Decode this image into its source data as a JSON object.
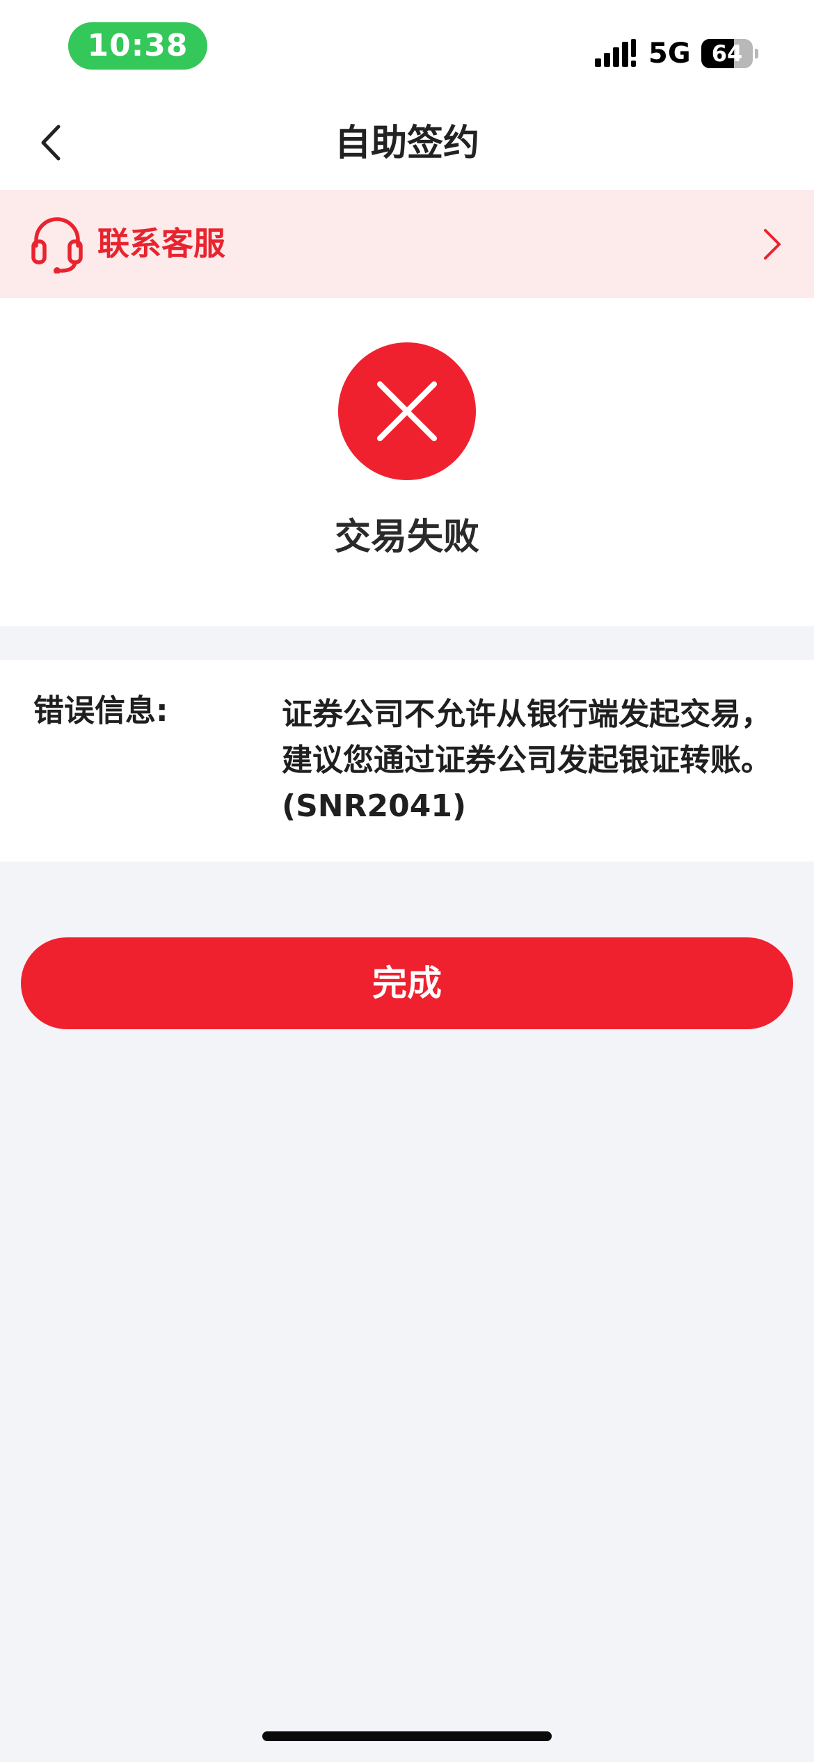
{
  "status_bar": {
    "time": "10:38",
    "network": "5G",
    "battery_level": "64",
    "battery_fraction": 0.64
  },
  "nav": {
    "title": "自助签约",
    "back_icon": "chevron-left-icon"
  },
  "service_banner": {
    "label": "联系客服",
    "icon": "headset-icon",
    "chevron_icon": "chevron-right-icon",
    "accent_color": "#e8242f",
    "background_color": "#fdeaea"
  },
  "result": {
    "icon": "fail-x-icon",
    "text": "交易失败",
    "icon_color": "#f0212f"
  },
  "error": {
    "label": "错误信息:",
    "message": "证券公司不允许从银行端发起交易，建议您通过证券公司发起银证转账。(SNR2041)"
  },
  "actions": {
    "done_label": "完成",
    "done_color": "#f0212f"
  }
}
